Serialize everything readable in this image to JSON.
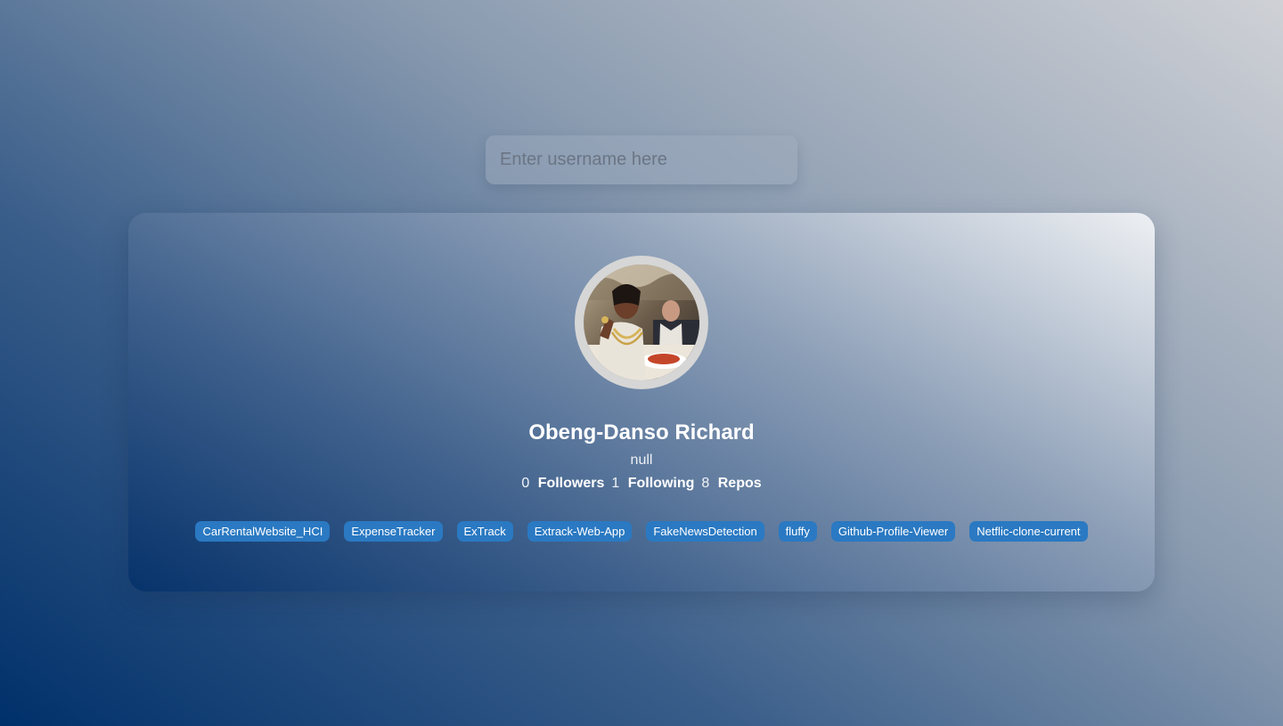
{
  "search": {
    "placeholder": "Enter username here",
    "value": ""
  },
  "profile": {
    "name": "Obeng-Danso Richard",
    "bio": "null",
    "avatar_alt": "avatar",
    "stats": {
      "followers_count": "0",
      "followers_label": "Followers",
      "following_count": "1",
      "following_label": "Following",
      "repos_count": "8",
      "repos_label": "Repos"
    },
    "repos": [
      "CarRentalWebsite_HCI",
      "ExpenseTracker",
      "ExTrack",
      "Extrack-Web-App",
      "FakeNewsDetection",
      "fluffy",
      "Github-Profile-Viewer",
      "Netflic-clone-current"
    ]
  },
  "colors": {
    "repo_tag_bg": "#2a79c2",
    "avatar_ring": "#d6d6d6",
    "text": "#ffffff"
  }
}
